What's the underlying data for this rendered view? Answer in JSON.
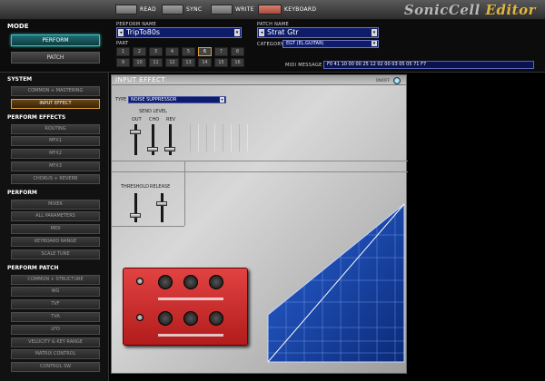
{
  "topbar": {
    "buttons": [
      {
        "label": "READ"
      },
      {
        "label": "SYNC"
      },
      {
        "label": "WRITE"
      },
      {
        "label": "KEYBOARD"
      }
    ],
    "logo_main": "SonicCell ",
    "logo_editor": "Editor"
  },
  "header": {
    "mode_label": "MODE",
    "perform_label": "PERFORM",
    "patch_label": "PATCH",
    "perform_name_label": "PERFORM NAME",
    "perform_name": "TripTo80s",
    "part_label": "PART",
    "parts": [
      "1",
      "2",
      "3",
      "4",
      "5",
      "6",
      "7",
      "8",
      "9",
      "10",
      "11",
      "12",
      "13",
      "14",
      "15",
      "16"
    ],
    "selected_part": "6",
    "patch_name_label": "PATCH NAME",
    "patch_name": "Strat Gtr",
    "category_label": "CATEGORY",
    "category_value": "EGT (EL.GUITAR)",
    "midi_message_label": "MIDI MESSAGE",
    "midi_message": "F0 41 10 00 00 25 12 02 00 03 05 05 71 F7"
  },
  "sidebar": {
    "sections": [
      {
        "title": "SYSTEM",
        "items": [
          "COMMON + MASTERING",
          "INPUT EFFECT"
        ]
      },
      {
        "title": "PERFORM EFFECTS",
        "items": [
          "ROUTING",
          "MFX1",
          "MFX2",
          "MFX3",
          "CHORUS + REVERB"
        ]
      },
      {
        "title": "PERFORM",
        "items": [
          "MIXER",
          "ALL PARAMETERS",
          "MIDI",
          "KEYBOARD RANGE",
          "SCALE TUNE"
        ]
      },
      {
        "title": "PERFORM PATCH",
        "items": [
          "COMMON + STRUCTURE",
          "WG",
          "TVF",
          "TVA",
          "LFO",
          "VELOCITY & KEY RANGE",
          "MATRIX CONTROL",
          "CONTROL SW"
        ]
      }
    ],
    "active_item": "INPUT EFFECT"
  },
  "main": {
    "panel_title": "INPUT EFFECT",
    "onoff_label": "ON/OFF",
    "type_label": "TYPE",
    "type_value": "NOISE SUPPRESSOR",
    "send_level_label": "SEND LEVEL",
    "send_sliders": [
      {
        "label": "OUT",
        "value": 0.78
      },
      {
        "label": "CHO",
        "value": 0.15
      },
      {
        "label": "REV",
        "value": 0.15
      }
    ],
    "threshold_label": "THRESHOLD",
    "release_label": "RELEASE",
    "threshold_value": 0.2,
    "release_value": 0.65
  }
}
